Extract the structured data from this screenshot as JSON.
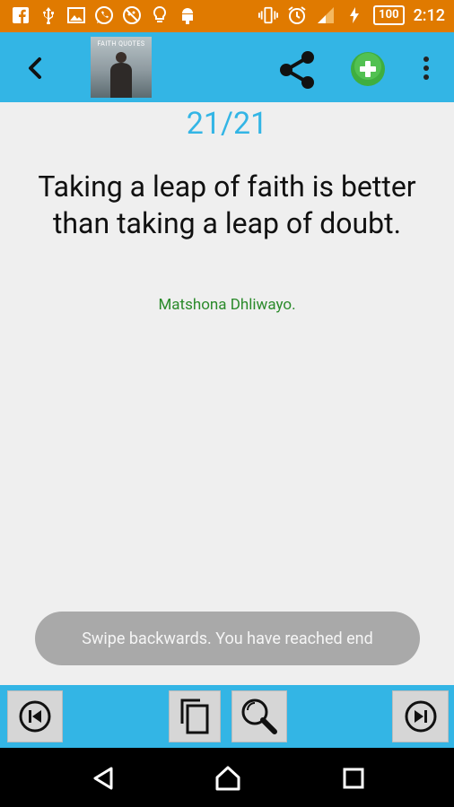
{
  "status_bar": {
    "time": "2:12",
    "battery": "100",
    "icons": [
      "facebook-icon",
      "usb-icon",
      "image-icon",
      "whatsapp-icon",
      "no-signal-icon",
      "bulb-icon",
      "android-icon"
    ]
  },
  "app_bar": {
    "thumbnail_title": "FAITH QUOTES"
  },
  "quote": {
    "counter": "21/21",
    "text": "Taking a leap of faith is better than taking a leap of doubt.",
    "author": "Matshona Dhliwayo."
  },
  "toast": {
    "message": "Swipe backwards. You have reached end"
  },
  "colors": {
    "status_bar": "#e07a00",
    "accent": "#33b5e5",
    "author": "#2a8a2a",
    "toast": "#a9a9a9",
    "add_button": "#3fae3f"
  }
}
